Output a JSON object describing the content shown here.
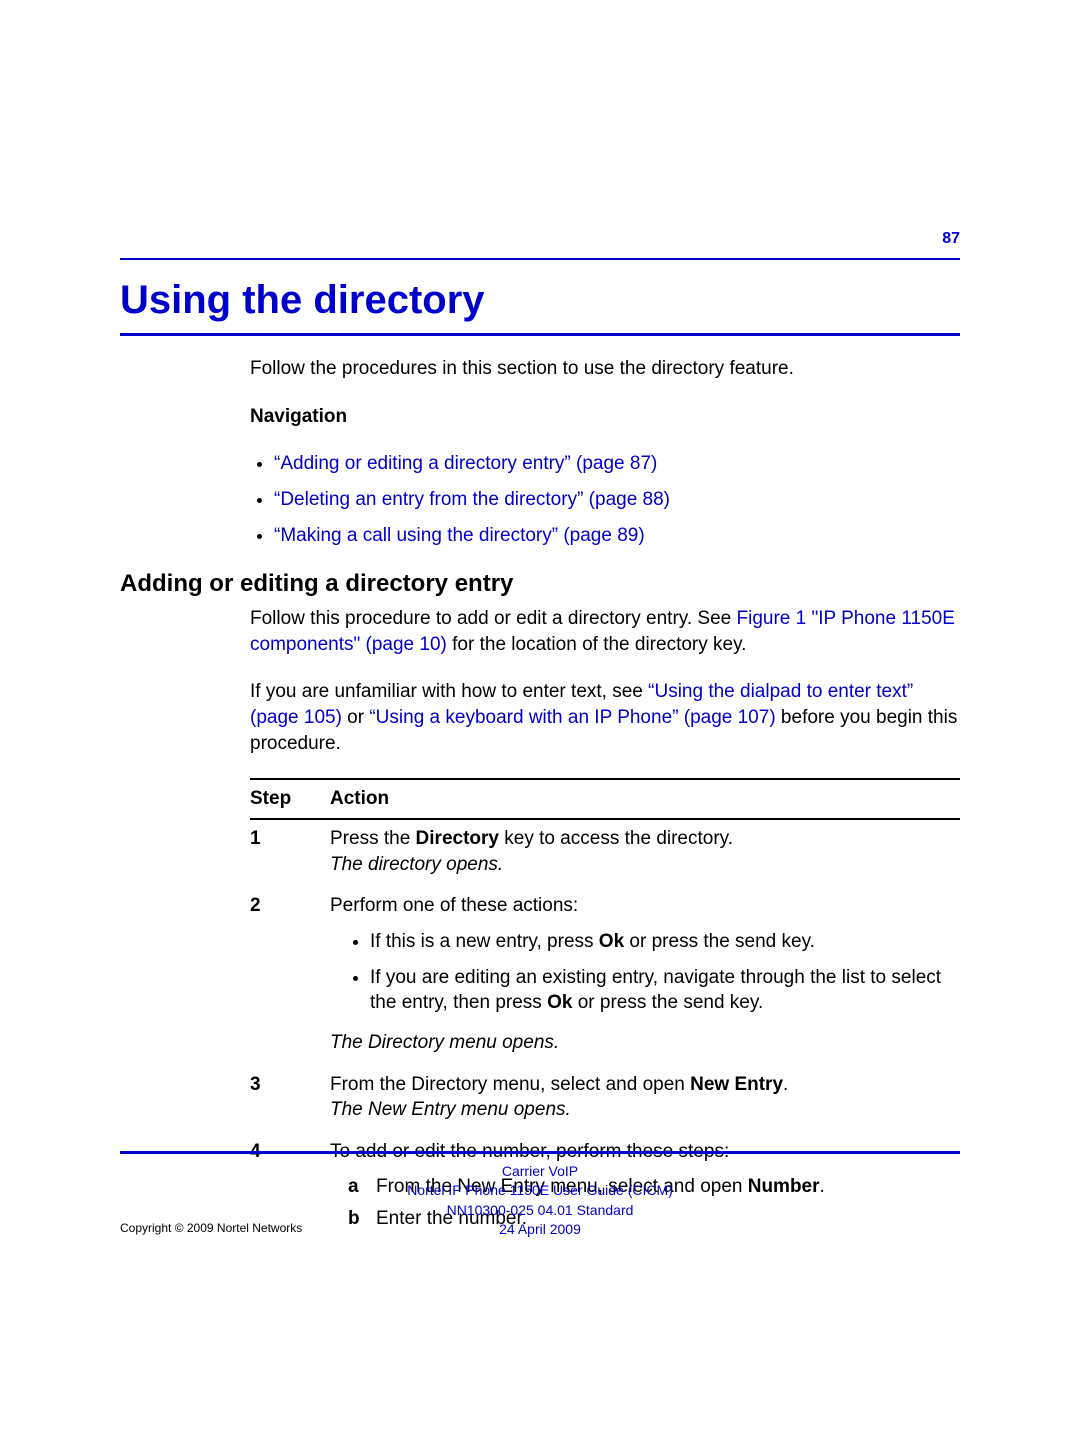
{
  "page_number": "87",
  "chapter_title": "Using the directory",
  "intro": "Follow the procedures in this section to use the directory feature.",
  "nav_heading": "Navigation",
  "nav_links": [
    "“Adding or editing a directory entry” (page 87)",
    "“Deleting an entry from the directory” (page 88)",
    "“Making a call using the directory” (page 89)"
  ],
  "section_title": "Adding or editing a directory entry",
  "section_p1_pre": "Follow this procedure to add or edit a directory entry. See ",
  "section_p1_link": "Figure 1 \"IP Phone 1150E components\" (page 10)",
  "section_p1_post": " for the location of the directory key.",
  "section_p2_pre": "If you are unfamiliar with how to enter text, see ",
  "section_p2_link1": "“Using the dialpad to enter text” (page 105)",
  "section_p2_mid": " or ",
  "section_p2_link2": "“Using a keyboard with an IP Phone” (page 107)",
  "section_p2_post": " before you begin this procedure.",
  "table": {
    "headers": {
      "step": "Step",
      "action": "Action"
    },
    "rows": [
      {
        "num": "1",
        "pre": "Press the ",
        "bold": "Directory",
        "post": " key to access the directory.",
        "result": "The directory opens."
      },
      {
        "num": "2",
        "text": "Perform one of these actions:",
        "bullets": [
          {
            "pre": "If this is a new entry, press ",
            "bold": "Ok",
            "post": " or press the send key."
          },
          {
            "pre": "If you are editing an existing entry, navigate through the list to select the entry, then press ",
            "bold": "Ok",
            "post": " or press the send key."
          }
        ],
        "result": "The Directory menu opens."
      },
      {
        "num": "3",
        "pre": "From the Directory menu, select and open ",
        "bold": "New Entry",
        "post": ".",
        "result": "The New Entry menu opens."
      },
      {
        "num": "4",
        "text": "To add or edit the number, perform these steps:",
        "substeps": [
          {
            "label": "a",
            "pre": "From the New Entry menu, select and open ",
            "bold": "Number",
            "post": "."
          },
          {
            "label": "b",
            "text": "Enter the number."
          }
        ]
      }
    ]
  },
  "footer": {
    "line1": "Carrier VoIP",
    "line2": "Nortel IP Phone 1150E User Guide (CICM)",
    "line3": "NN10300-025   04.01   Standard",
    "line4": "24 April 2009"
  },
  "copyright": "Copyright © 2009 Nortel Networks"
}
